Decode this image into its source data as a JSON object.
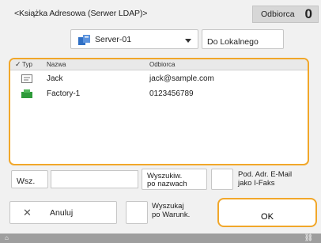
{
  "header": {
    "title": "<Książka Adresowa (Serwer LDAP)>",
    "recipient_label": "Odbiorca",
    "recipient_count": "0"
  },
  "server": {
    "selected": "Server-01",
    "icon": "server-icon"
  },
  "buttons": {
    "to_local": "Do Lokalnego",
    "wsz": "Wsz.",
    "search_by_name_line1": "Wyszukiw.",
    "search_by_name_line2": "po nazwach",
    "email_ifax_line1": "Pod. Adr. E-Mail",
    "email_ifax_line2": "jako I-Faks",
    "cancel": "Anuluj",
    "advanced_line1": "Wyszukaj",
    "advanced_line2": "po Warunk.",
    "ok": "OK"
  },
  "list": {
    "headers": {
      "check": "✓",
      "type": "Typ",
      "name": "Nazwa",
      "recipient": "Odbiorca"
    },
    "rows": [
      {
        "type_icon": "email-icon",
        "name": "Jack",
        "value": "jack@sample.com"
      },
      {
        "type_icon": "fax-icon",
        "name": "Factory-1",
        "value": "0123456789"
      }
    ]
  },
  "search": {
    "value": ""
  },
  "colors": {
    "accent": "#f1a72a",
    "fax_green": "#2e9a3a",
    "server_blue": "#2f6fc4"
  }
}
